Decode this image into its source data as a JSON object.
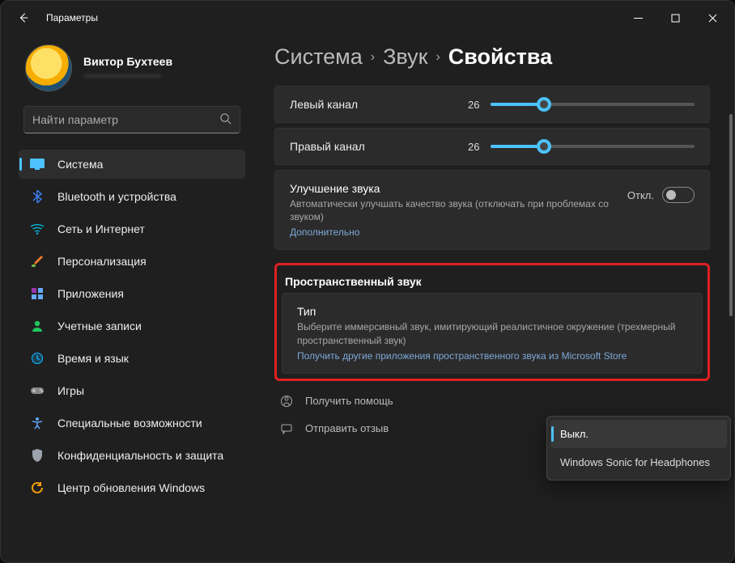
{
  "titlebar": {
    "app_title": "Параметры"
  },
  "profile": {
    "name": "Виктор Бухтеев",
    "email": "————————"
  },
  "search": {
    "placeholder": "Найти параметр"
  },
  "nav": [
    {
      "label": "Система",
      "icon": "system-icon",
      "color": "#4cc2ff"
    },
    {
      "label": "Bluetooth и устройства",
      "icon": "bluetooth-icon",
      "color": "#3b82f6"
    },
    {
      "label": "Сеть и Интернет",
      "icon": "network-icon",
      "color": "#06b6d4"
    },
    {
      "label": "Персонализация",
      "icon": "brush-icon",
      "color": "#ef7a2a"
    },
    {
      "label": "Приложения",
      "icon": "apps-icon",
      "color": "#64748b"
    },
    {
      "label": "Учетные записи",
      "icon": "accounts-icon",
      "color": "#22c55e"
    },
    {
      "label": "Время и язык",
      "icon": "time-icon",
      "color": "#0ea5e9"
    },
    {
      "label": "Игры",
      "icon": "gaming-icon",
      "color": "#a3a3a3"
    },
    {
      "label": "Специальные возможности",
      "icon": "accessibility-icon",
      "color": "#60a5fa"
    },
    {
      "label": "Конфиденциальность и защита",
      "icon": "privacy-icon",
      "color": "#9ca3af"
    },
    {
      "label": "Центр обновления Windows",
      "icon": "update-icon",
      "color": "#f59e0b"
    }
  ],
  "breadcrumb": {
    "a": "Система",
    "b": "Звук",
    "c": "Свойства",
    "sep": "›"
  },
  "sliders": {
    "left": {
      "label": "Левый канал",
      "value": 26,
      "max": 100
    },
    "right": {
      "label": "Правый канал",
      "value": 26,
      "max": 100
    }
  },
  "enhance": {
    "title": "Улучшение звука",
    "subtitle": "Автоматически улучшать качество звука (отключать при проблемах со звуком)",
    "link": "Дополнительно",
    "state": "Откл."
  },
  "spatial": {
    "section": "Пространственный звук",
    "title": "Тип",
    "desc": "Выберите иммерсивный звук, имитирующий реалистичное окружение (трехмерный пространственный звук)",
    "link1": "Получить другие приложения пространственного звука из",
    "link2": "Microsoft Store"
  },
  "dropdown": {
    "opt1": "Выкл.",
    "opt2": "Windows Sonic for Headphones"
  },
  "help": {
    "get_help": "Получить помощь",
    "feedback": "Отправить отзыв"
  }
}
